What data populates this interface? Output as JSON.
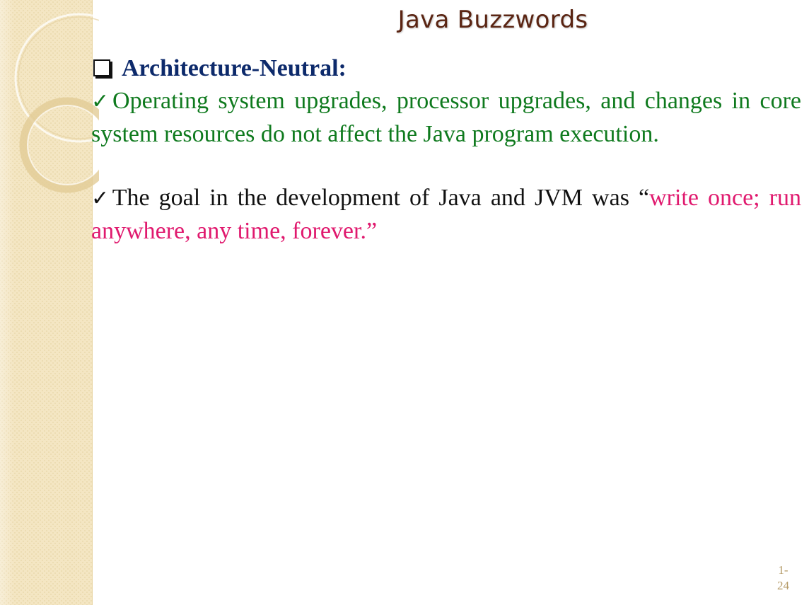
{
  "slide": {
    "title": "Java Buzzwords",
    "heading": "Architecture-Neutral:",
    "paragraph1": "Operating system upgrades, processor upgrades, and changes in core system resources do not affect  the Java program execution.",
    "paragraph2_start": "The goal in the development of  Java and JVM was “",
    "paragraph2_highlight": "write once; run anywhere, any time, forever.”",
    "check_mark": "✓",
    "page_number_line1": "1-",
    "page_number_line2": "24"
  },
  "colors": {
    "title": "#5a2412",
    "heading": "#0d2a6b",
    "paragraph1": "#0f7a1e",
    "paragraph2": "#111111",
    "highlight": "#e0196e",
    "strip": "#f4e6c3"
  },
  "icons": {
    "heading_bullet": "square-checkbox-icon",
    "paragraph_bullet": "check-mark-icon"
  }
}
